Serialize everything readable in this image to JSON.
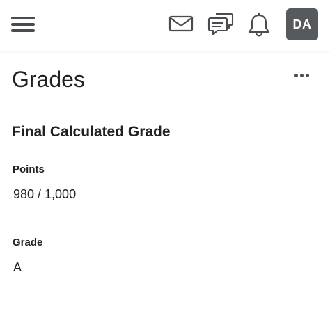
{
  "navbar": {
    "menu_icon": "hamburger-menu-icon",
    "icons": [
      "envelope-icon",
      "chat-bubbles-icon",
      "bell-icon"
    ],
    "avatar_initials": "DA",
    "avatar_color": "#565a5c"
  },
  "page": {
    "title": "Grades",
    "more_icon": "more-horizontal-icon"
  },
  "final_grade": {
    "heading": "Final Calculated Grade",
    "points_label": "Points",
    "points_value": "980 / 1,000",
    "grade_label": "Grade",
    "grade_value": "A"
  },
  "colors": {
    "text": "#202122",
    "icon": "#494c4e",
    "background": "#ffffff"
  }
}
